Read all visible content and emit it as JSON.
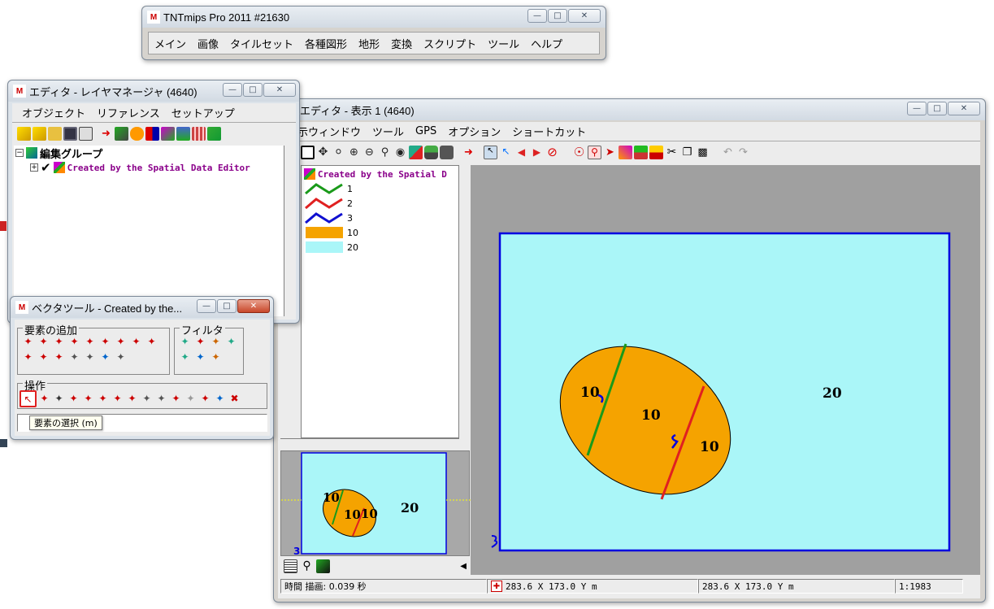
{
  "main_window": {
    "title": "TNTmips Pro 2011  #21630",
    "menus": [
      "メイン",
      "画像",
      "タイルセット",
      "各種図形",
      "地形",
      "変換",
      "スクリプト",
      "ツール",
      "ヘルプ"
    ]
  },
  "layer_manager": {
    "title": "エディタ - レイヤマネージャ (4640)",
    "menus": [
      "オブジェクト",
      "リファレンス",
      "セットアップ"
    ],
    "tree": {
      "group_label": "編集グループ",
      "layer_label": "Created by the Spatial Data Editor"
    }
  },
  "display_window": {
    "title": "エディタ - 表示 1 (4640)",
    "menus": [
      "示ウィンドウ",
      "ツール",
      "GPS",
      "オプション",
      "ショートカット"
    ],
    "legend": {
      "layer_label": "Created by the Spatial D",
      "items": [
        {
          "label": "1",
          "color": "#1a9a1a",
          "kind": "line"
        },
        {
          "label": "2",
          "color": "#e02020",
          "kind": "line"
        },
        {
          "label": "3",
          "color": "#1010d0",
          "kind": "line"
        },
        {
          "label": "10",
          "color": "#f5a300",
          "kind": "fill"
        },
        {
          "label": "20",
          "color": "#aaf6f8",
          "kind": "fill"
        }
      ]
    },
    "map_labels": {
      "big_ellipse_left": "10",
      "big_ellipse_center": "10",
      "big_ellipse_right": "10",
      "outer": "20"
    },
    "overview_labels": {
      "left": "10",
      "center": "10",
      "right": "10",
      "outer": "20"
    },
    "status": {
      "time": "時間 描画: 0.039 秒",
      "coord1": "283.6 X  173.0 Y m",
      "coord2": "283.6 X  173.0 Y m",
      "scale": "1:1983"
    },
    "colors": {
      "map_bg": "#a0a0a0",
      "polygon_fill": "#aaf6f8",
      "ellipse_fill": "#f5a300",
      "boundary": "#0000e0"
    }
  },
  "vector_tools": {
    "title": "ベクタツール - Created by the...",
    "groups": {
      "add": "要素の追加",
      "filter": "フィルタ",
      "operate": "操作"
    },
    "tooltip": "要素の選択  (m)"
  }
}
